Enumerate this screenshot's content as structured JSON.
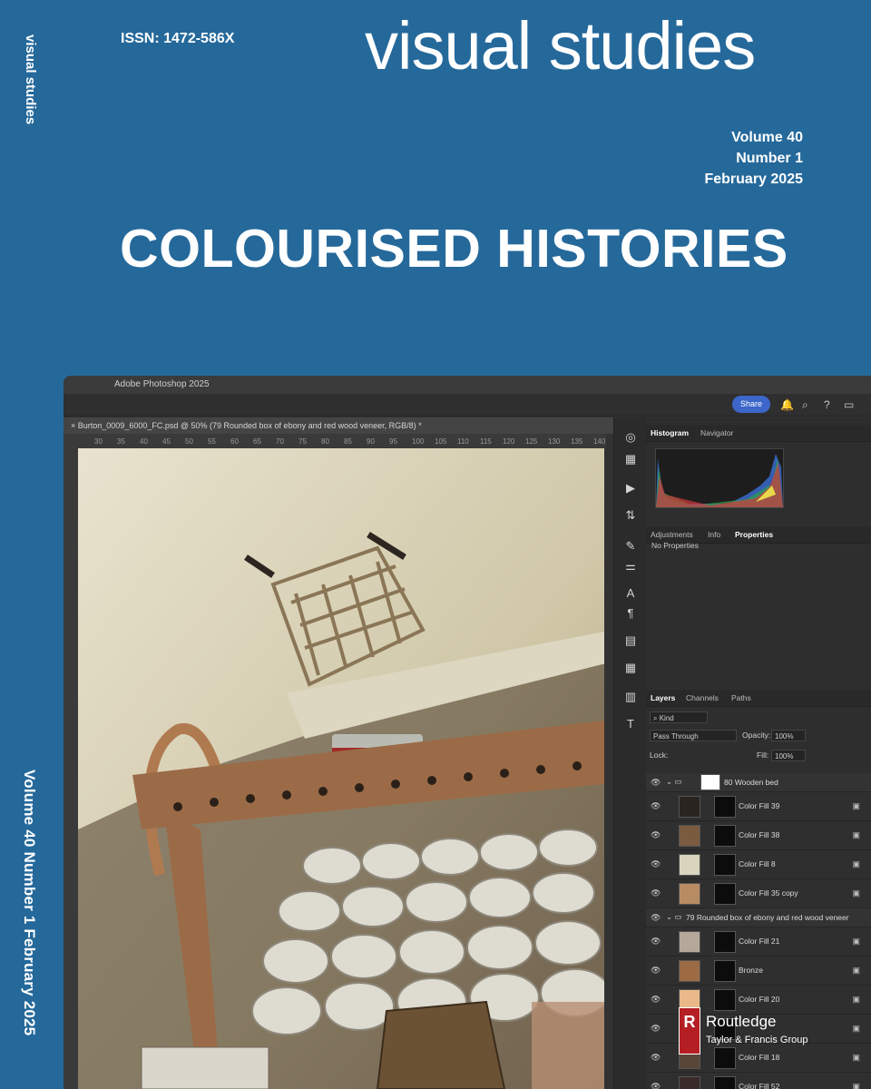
{
  "cover": {
    "spine_title": "visual studies",
    "spine_issue": "Volume 40  Number 1  February 2025",
    "issn": "ISSN: 1472-586X",
    "masthead": "visual studies",
    "volume": "Volume 40",
    "number": "Number 1",
    "date": "February 2025",
    "theme": "COLOURISED HISTORIES",
    "publisher": {
      "name": "Routledge",
      "group": "Taylor & Francis Group",
      "logo_letter": "R"
    },
    "colors": {
      "background": "#25699b",
      "text": "#ffffff",
      "publisher_red": "#b51f24"
    }
  },
  "photoshop": {
    "app_title": "Adobe Photoshop 2025",
    "share_label": "Share",
    "doc_tab": "Burton_0009_6000_FC.psd @ 50% (79 Rounded box of ebony and red wood veneer, RGB/8) *",
    "ruler_ticks": [
      "30",
      "35",
      "40",
      "45",
      "50",
      "55",
      "60",
      "65",
      "70",
      "75",
      "80",
      "85",
      "90",
      "95",
      "100",
      "105",
      "110",
      "115",
      "120",
      "125",
      "130",
      "135",
      "140"
    ],
    "panel_tabs_top": [
      "Histogram",
      "Navigator"
    ],
    "panel_tabs_mid": [
      "Adjustments",
      "Info",
      "Properties"
    ],
    "no_properties": "No Properties",
    "panel_tabs_layers": [
      "Layers",
      "Channels",
      "Paths"
    ],
    "kind_filter": "Kind",
    "blend_mode": "Pass Through",
    "opacity_label": "Opacity:",
    "opacity_value": "100%",
    "lock_label": "Lock:",
    "fill_label": "Fill:",
    "fill_value": "100%",
    "layers": [
      {
        "name": "80 Wooden bed",
        "group": true,
        "swatch": "#ffffff"
      },
      {
        "name": "Color Fill 39",
        "swatch": "#2a2420"
      },
      {
        "name": "Color Fill 38",
        "swatch": "#7a5b3f"
      },
      {
        "name": "Color Fill 8",
        "swatch": "#d8d4bd"
      },
      {
        "name": "Color Fill 35 copy",
        "swatch": "#b88c62"
      },
      {
        "name": "79 Rounded box of ebony and red wood veneer",
        "group": true
      },
      {
        "name": "Color Fill 21",
        "swatch": "#b5a89a"
      },
      {
        "name": "Bronze",
        "swatch": "#9c6b44"
      },
      {
        "name": "Color Fill 20",
        "swatch": "#e9b98a"
      },
      {
        "name": "",
        "swatch": "#c7a27a"
      },
      {
        "name": "Color Fill 18",
        "swatch": "#5a4638"
      },
      {
        "name": "Color Fill 52",
        "swatch": "#3a2b2b"
      }
    ]
  }
}
